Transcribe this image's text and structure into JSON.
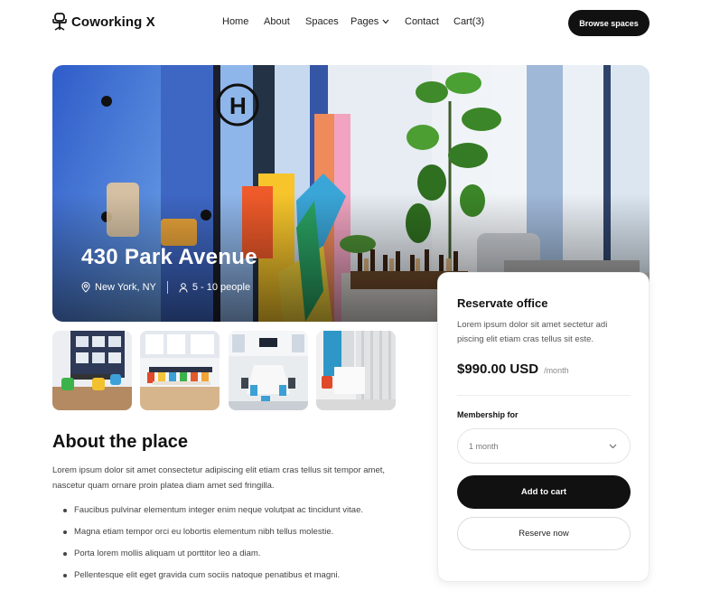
{
  "header": {
    "brand": "Coworking X",
    "nav": [
      {
        "label": "Home"
      },
      {
        "label": "About"
      },
      {
        "label": "Spaces"
      },
      {
        "label": "Pages"
      },
      {
        "label": "Contact"
      },
      {
        "label": "Cart(3)"
      }
    ],
    "cta": "Browse spaces"
  },
  "hero": {
    "title": "430 Park Avenue",
    "location": "New York, NY",
    "capacity": "5 - 10 people"
  },
  "about": {
    "title": "About the place",
    "text": "Lorem ipsum dolor sit amet consectetur adipiscing elit etiam cras tellus sit tempor amet, nascetur quam ornare proin platea diam amet sed fringilla.",
    "bullets": [
      "Faucibus pulvinar elementum integer enim neque volutpat ac tincidunt vitae.",
      "Magna etiam tempor orci eu lobortis elementum nibh tellus molestie.",
      "Porta lorem mollis aliquam ut porttitor leo a diam.",
      "Pellentesque elit eget gravida cum sociis natoque penatibus et magni."
    ]
  },
  "card": {
    "title": "Reservate office",
    "description": "Lorem ipsum dolor sit amet sectetur adi piscing elit etiam cras tellus sit este.",
    "price": "$990.00 USD",
    "period": "/month",
    "membership_label": "Membership for",
    "membership_value": "1 month",
    "add_to_cart": "Add to cart",
    "reserve": "Reserve now"
  },
  "colors": {
    "primary": "#111111",
    "text_muted": "#444444"
  }
}
